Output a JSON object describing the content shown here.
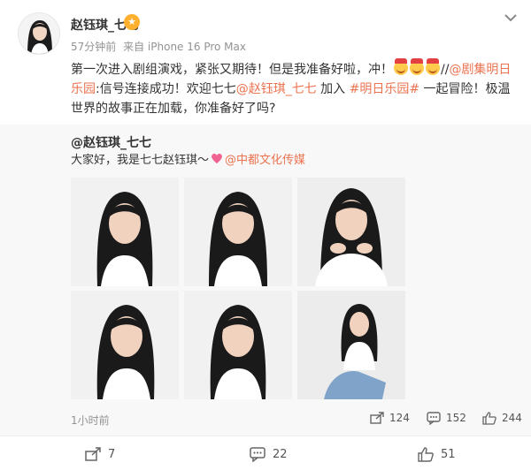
{
  "post": {
    "author": "赵钰琪_七七",
    "time": "57分钟前",
    "source": "来自 iPhone 16 Pro Max",
    "content": {
      "p1": "第一次进入剧组演戏，紧张又期待！但是我准备好啦，冲！",
      "p2": "//",
      "link1": "@剧集明日乐园",
      "p3": ":信号连接成功！欢迎七七",
      "link2": "@赵钰琪_七七",
      "p4": " 加入 ",
      "link3": "#明日乐园#",
      "p5": " 一起冒险！极温世界的故事正在加载，你准备好了吗?"
    },
    "emoji_name": "celebrate-emoji"
  },
  "repost": {
    "author": "@赵钰琪_七七",
    "text": "大家好，我是七七赵钰琪～",
    "link": "@中都文化传媒",
    "time": "1小时前",
    "reposts": "124",
    "comments": "152",
    "likes": "244",
    "photo_count": 6
  },
  "actions": {
    "share": "7",
    "comment": "22",
    "like": "51"
  },
  "colors": {
    "link": "#eb7350",
    "muted": "#939393",
    "repost_bg": "#f8f8f8"
  }
}
